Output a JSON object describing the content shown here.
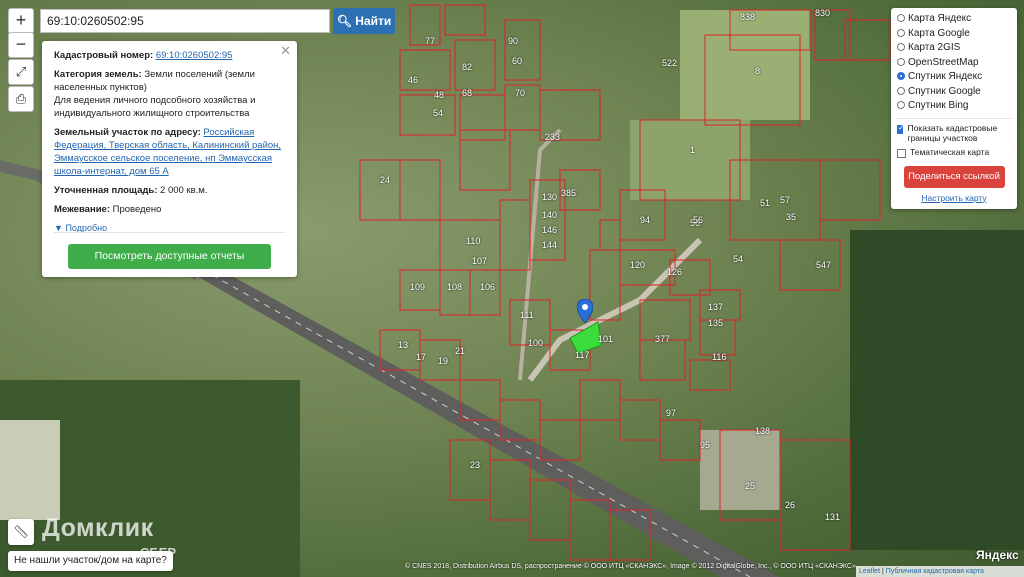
{
  "search": {
    "value": "69:10:0260502:95",
    "button_label": "Найти"
  },
  "zoom": {
    "in_label": "+",
    "out_label": "−"
  },
  "info": {
    "cadastral_label": "Кадастровый номер:",
    "cadastral_number": "69:10:0260502:95",
    "category_label": "Категория земель:",
    "category_value": "Земли поселений (земли населенных пунктов)",
    "usage_value": "Для ведения личного подсобного хозяйства и индивидуального жилищного строительства",
    "address_label": "Земельный участок по адресу:",
    "address_value": "Российская Федерация, Тверская область, Калининский район, Эммаусское сельское поселение, нп Эммаусская школа-интернат, дом 65 А",
    "area_label": "Уточненная площадь:",
    "area_value": "2 000 кв.м.",
    "survey_label": "Межевание:",
    "survey_value": "Проведено",
    "details_link": "Подробно",
    "reports_button": "Посмотреть доступные отчеты"
  },
  "layers": {
    "options": [
      {
        "label": "Карта Яндекс",
        "selected": false
      },
      {
        "label": "Карта Google",
        "selected": false
      },
      {
        "label": "Карта 2GIS",
        "selected": false
      },
      {
        "label": "OpenStreetMap",
        "selected": false
      },
      {
        "label": "Спутник Яндекс",
        "selected": true
      },
      {
        "label": "Спутник Google",
        "selected": false
      },
      {
        "label": "Спутник Bing",
        "selected": false
      }
    ],
    "show_borders_label": "Показать кадастровые границы участков",
    "show_borders_checked": true,
    "thematic_label": "Тематическая карта",
    "thematic_checked": false,
    "share_button": "Поделиться ссылкой",
    "customize_link": "Настроить карту"
  },
  "plot_numbers": [
    "838",
    "830",
    "8",
    "522",
    "77",
    "82",
    "90",
    "60",
    "68",
    "70",
    "46",
    "48",
    "54",
    "56",
    "1",
    "233",
    "385",
    "130",
    "140",
    "146",
    "144",
    "110",
    "107",
    "109",
    "108",
    "106",
    "111",
    "100",
    "120",
    "126",
    "137",
    "135",
    "116",
    "97",
    "95",
    "25",
    "138",
    "26",
    "131",
    "547",
    "54",
    "56",
    "57",
    "51",
    "35",
    "94",
    "117",
    "101",
    "377",
    "24",
    "13",
    "17",
    "19",
    "21",
    "23"
  ],
  "bottom": {
    "not_found_text": "Не нашли участок/дом на карте?",
    "brand": "Домклик",
    "brand_sub": "СБЕР",
    "yandex_logo": "Яндекс",
    "copyright": "© CNES 2018, Distribution Airbus DS, распространение © ООО ИТЦ «СКАНЭКС», Image © 2012 DigitalGlobe, Inc., © ООО ИТЦ «СКАНЭКС»",
    "attribution_leaflet": "Leaflet",
    "attribution_text": "Публичная кадастровая карта"
  },
  "colors": {
    "boundary": "#e0202a",
    "selected_plot": "#3ddc3d",
    "accent": "#2c6fb3",
    "share": "#d9433c",
    "reports": "#3fae4a"
  }
}
